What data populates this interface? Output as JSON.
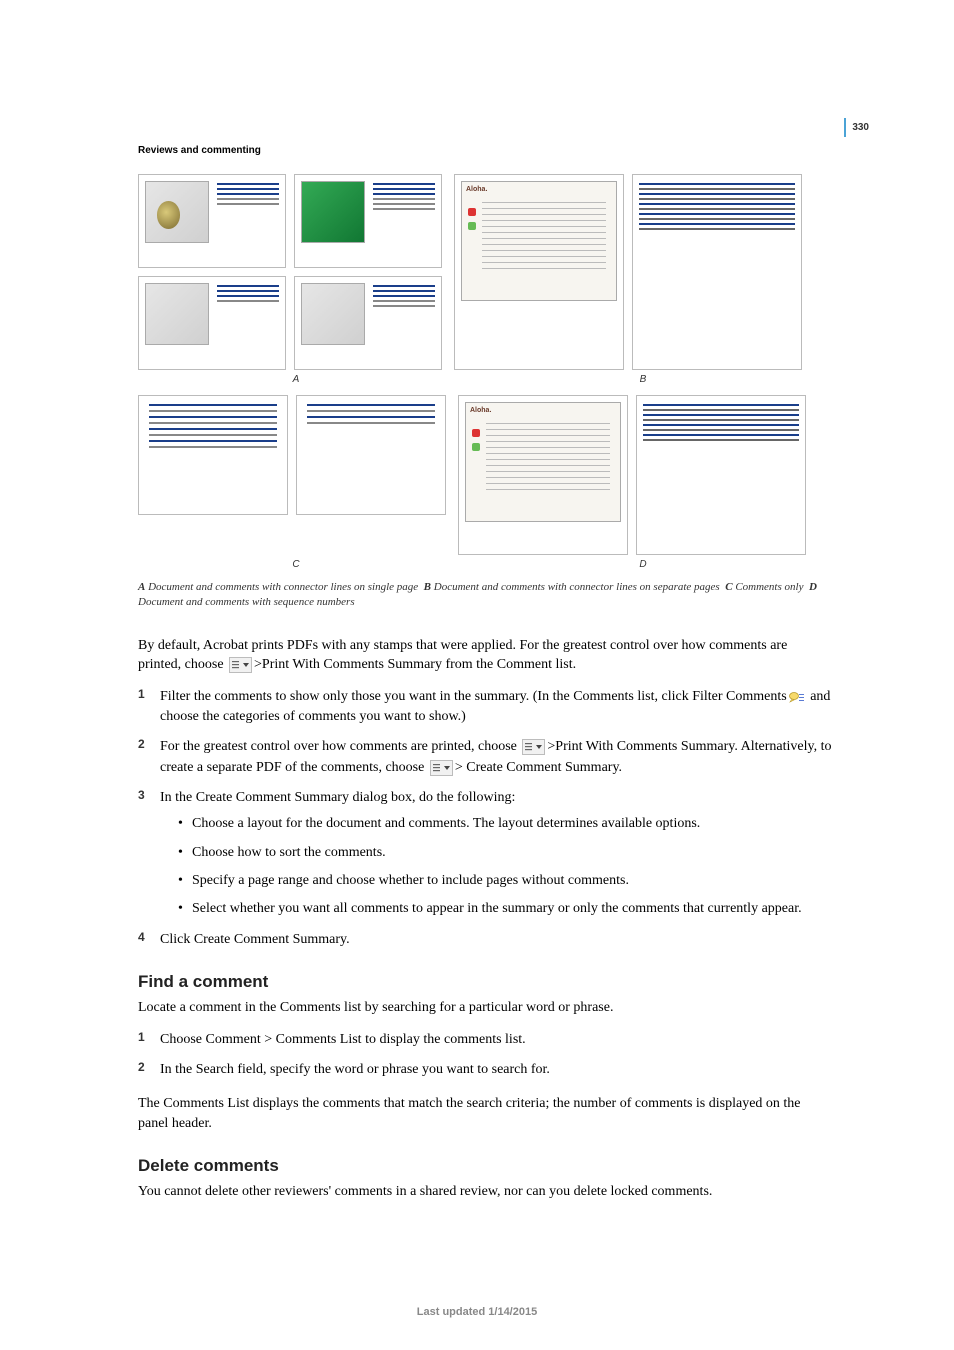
{
  "page_number": "330",
  "chapter": "Reviews and commenting",
  "caption": {
    "a_label": "A",
    "a_text": "Document and comments with connector lines on single page",
    "b_label": "B",
    "b_text": "Document and comments with connector lines on separate pages",
    "c_label": "C",
    "c_text": "Comments only",
    "d_label": "D",
    "d_text": "Document and comments with sequence numbers"
  },
  "letters": {
    "a": "A",
    "b": "B",
    "c": "C",
    "d": "D"
  },
  "intro": {
    "line1": "By default, Acrobat prints PDFs with any stamps that were applied. For the greatest control over how comments are printed, choose ",
    "line2": ">Print With Comments Summary from the Comment list."
  },
  "steps_print": {
    "s1a": "Filter the comments to show only those you want in the summary. (In the Comments list, click Filter Comments",
    "s1b": "and choose the categories of comments you want to show.)",
    "s2a": "For the greatest control over how comments are printed, choose ",
    "s2b": ">Print With Comments Summary. Alternatively, to create a separate PDF of the comments, choose ",
    "s2c": "> Create Comment Summary.",
    "s3": "In the Create Comment Summary dialog box, do the following:",
    "s3_b1": "Choose a layout for the document and comments. The layout determines available options.",
    "s3_b2": "Choose how to sort the comments.",
    "s3_b3": "Specify a page range and choose whether to include pages without comments.",
    "s3_b4": "Select whether you want all comments to appear in the summary or only the comments that currently appear.",
    "s4": "Click Create Comment Summary."
  },
  "find": {
    "heading": "Find a comment",
    "intro": "Locate a comment in the Comments list by searching for a particular word or phrase.",
    "s1": "Choose Comment > Comments List to display the comments list.",
    "s2": "In the Search field, specify the word or phrase you want to search for.",
    "outro": "The Comments List displays the comments that match the search criteria; the number of comments is displayed on the panel header."
  },
  "delete": {
    "heading": "Delete comments",
    "body": "You cannot delete other reviewers' comments in a shared review, nor can you delete locked comments."
  },
  "footer": "Last updated 1/14/2015"
}
